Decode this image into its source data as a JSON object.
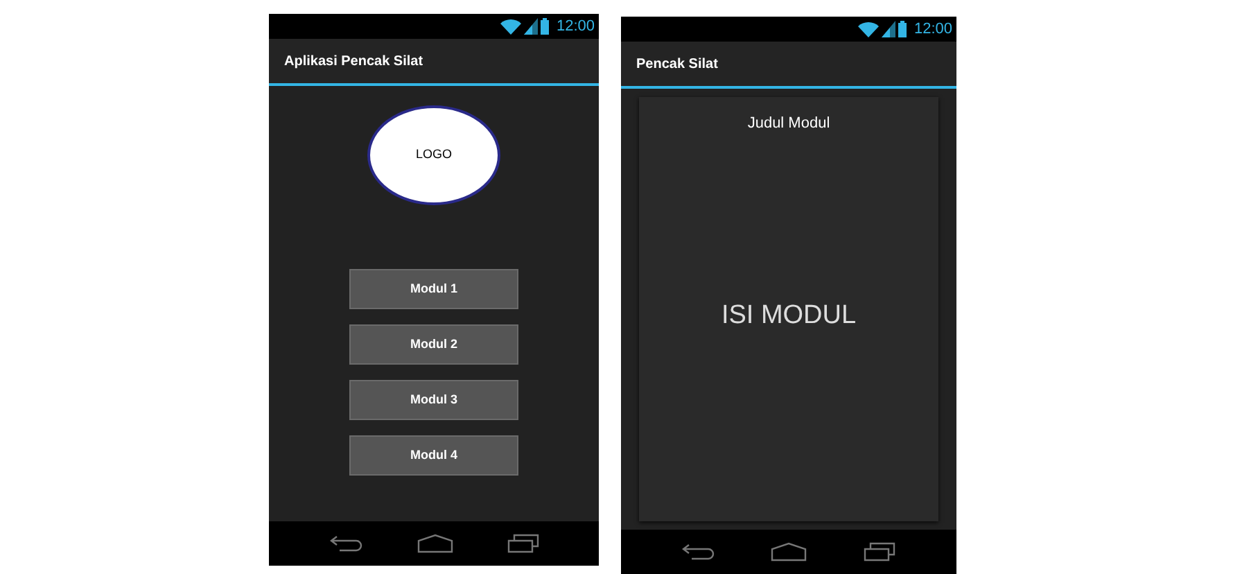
{
  "screens": [
    {
      "kind": "menu",
      "status_bar": {
        "time": "12:00"
      },
      "title": "Aplikasi Pencak Silat",
      "logo": {
        "label": "LOGO"
      },
      "buttons": [
        "Modul 1",
        "Modul 2",
        "Modul 3",
        "Modul 4"
      ]
    },
    {
      "kind": "detail",
      "status_bar": {
        "time": "12:00"
      },
      "title": "Pencak Silat",
      "card": {
        "title": "Judul Modul",
        "content": "ISI MODUL"
      }
    }
  ]
}
